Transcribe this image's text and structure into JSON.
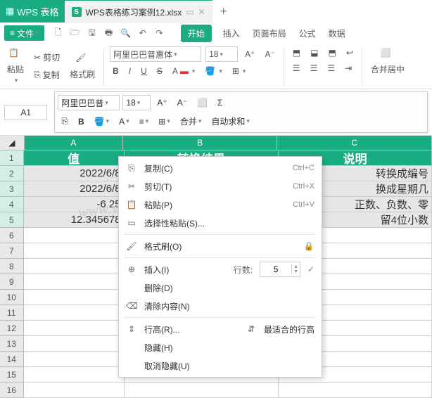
{
  "title": {
    "app": "WPS 表格",
    "doc": "WPS表格练习案例12.xlsx"
  },
  "menu": {
    "file": "文件"
  },
  "tabs": {
    "start": "开始",
    "insert": "插入",
    "layout": "页面布局",
    "formula": "公式",
    "data": "数据"
  },
  "ribbon": {
    "paste": "粘贴",
    "cut": "剪切",
    "copy": "复制",
    "formatpainter": "格式刷",
    "font": "阿里巴巴普惠体",
    "size": "18",
    "merge": "合并居中"
  },
  "namebox": "A1",
  "minibar": {
    "font": "阿里巴巴普",
    "size": "18",
    "merge": "合并",
    "autosum": "自动求和"
  },
  "cols": {
    "a": "A",
    "b": "B",
    "c": "C"
  },
  "headers": {
    "val": "值",
    "result": "转换结果",
    "desc": "说明"
  },
  "rows": [
    {
      "n": "1"
    },
    {
      "n": "2",
      "val": "2022/6/8",
      "desc": "转换成编号"
    },
    {
      "n": "3",
      "val": "2022/6/8",
      "desc": "换成星期几"
    },
    {
      "n": "4",
      "val": "-6.25",
      "desc": "正数、负数、零"
    },
    {
      "n": "5",
      "val": "12.345678",
      "desc": "留4位小数"
    },
    {
      "n": "6"
    },
    {
      "n": "7"
    },
    {
      "n": "8"
    },
    {
      "n": "9"
    },
    {
      "n": "10"
    },
    {
      "n": "11"
    },
    {
      "n": "12"
    },
    {
      "n": "13"
    },
    {
      "n": "14"
    },
    {
      "n": "15"
    },
    {
      "n": "16"
    }
  ],
  "ctx": {
    "copy": "复制(C)",
    "copy_sc": "Ctrl+C",
    "cut": "剪切(T)",
    "cut_sc": "Ctrl+X",
    "paste": "粘贴(P)",
    "paste_sc": "Ctrl+V",
    "pastesp": "选择性粘贴(S)...",
    "fmtpaint": "格式刷(O)",
    "insert": "插入(I)",
    "rows_lbl": "行数:",
    "rows_val": "5",
    "delete": "删除(D)",
    "clear": "清除内容(N)",
    "rowh": "行高(R)...",
    "bestfit": "最适合的行高",
    "hide": "隐藏(H)",
    "unhide": "取消隐藏(U)"
  },
  "watermark": "www.yigujin.cn"
}
